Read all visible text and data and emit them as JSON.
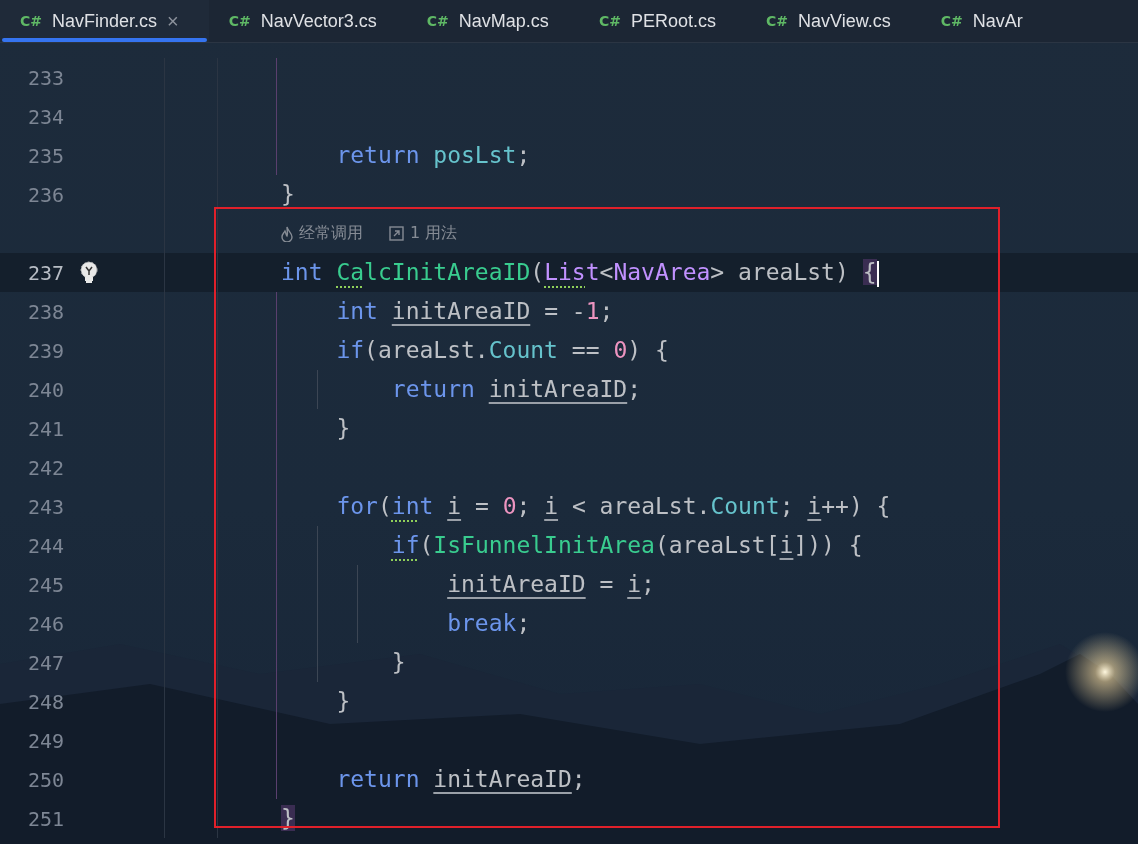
{
  "tabs": [
    {
      "icon": "C#",
      "label": "NavFinder.cs",
      "selected": true,
      "close": "×"
    },
    {
      "icon": "C#",
      "label": "NavVector3.cs",
      "selected": false
    },
    {
      "icon": "C#",
      "label": "NavMap.cs",
      "selected": false
    },
    {
      "icon": "C#",
      "label": "PERoot.cs",
      "selected": false
    },
    {
      "icon": "C#",
      "label": "NavView.cs",
      "selected": false
    },
    {
      "icon": "C#",
      "label": "NavAr",
      "selected": false
    }
  ],
  "editor": {
    "highlight_box": true,
    "lines": [
      {
        "kind": "code",
        "number": "233",
        "current": false
      },
      {
        "kind": "code",
        "number": "234",
        "current": false
      },
      {
        "kind": "code",
        "number": "235",
        "current": false,
        "tokens": [
          {
            "t": "    return ",
            "kind": "keyword"
          },
          {
            "t": "posLst",
            "kind": "field"
          },
          {
            "t": ";"
          }
        ]
      },
      {
        "kind": "code",
        "number": "236",
        "current": false,
        "tokens": [
          {
            "t": "}"
          }
        ]
      },
      {
        "kind": "hint",
        "usage_hint": "经常调用",
        "usages": "1 用法"
      },
      {
        "kind": "code",
        "number": "237",
        "current": true,
        "bulb": true,
        "caret": true,
        "tokens": [
          {
            "t": "int ",
            "kind": "keyword"
          },
          {
            "t": "Ca",
            "kind": "function",
            "hint_underline": true
          },
          {
            "t": "lcInitAreaID",
            "kind": "function"
          },
          {
            "t": "("
          },
          {
            "t": "Lis",
            "kind": "type",
            "hint_underline": true
          },
          {
            "t": "t",
            "kind": "type"
          },
          {
            "t": "<"
          },
          {
            "t": "NavArea",
            "kind": "type"
          },
          {
            "t": "> areaLst) "
          },
          {
            "t": "{",
            "brace_highlight": true
          }
        ]
      },
      {
        "kind": "code",
        "number": "238",
        "current": false,
        "tokens": [
          {
            "t": "    int ",
            "kind": "keyword"
          },
          {
            "t": "initAreaID",
            "underlined": true
          },
          {
            "t": " = -"
          },
          {
            "t": "1",
            "kind": "number"
          },
          {
            "t": ";"
          }
        ]
      },
      {
        "kind": "code",
        "number": "239",
        "current": false,
        "tokens": [
          {
            "t": "    if",
            "kind": "keyword"
          },
          {
            "t": "(areaLst."
          },
          {
            "t": "Count",
            "kind": "field"
          },
          {
            "t": " == "
          },
          {
            "t": "0",
            "kind": "number"
          },
          {
            "t": ") {"
          }
        ]
      },
      {
        "kind": "code",
        "number": "240",
        "current": false,
        "tokens": [
          {
            "t": "        return ",
            "kind": "keyword"
          },
          {
            "t": "initAreaID",
            "underlined": true
          },
          {
            "t": ";"
          }
        ]
      },
      {
        "kind": "code",
        "number": "241",
        "current": false,
        "tokens": [
          {
            "t": "    }"
          }
        ]
      },
      {
        "kind": "code",
        "number": "242",
        "current": false
      },
      {
        "kind": "code",
        "number": "243",
        "current": false,
        "tokens": [
          {
            "t": "    for",
            "kind": "keyword"
          },
          {
            "t": "("
          },
          {
            "t": "in",
            "kind": "keyword",
            "hint_underline": true
          },
          {
            "t": "t ",
            "kind": "keyword"
          },
          {
            "t": "i",
            "underlined": true
          },
          {
            "t": " = "
          },
          {
            "t": "0",
            "kind": "number"
          },
          {
            "t": "; "
          },
          {
            "t": "i",
            "underlined": true
          },
          {
            "t": " < areaLst."
          },
          {
            "t": "Count",
            "kind": "field"
          },
          {
            "t": "; "
          },
          {
            "t": "i",
            "underlined": true
          },
          {
            "t": "++) {"
          }
        ]
      },
      {
        "kind": "code",
        "number": "244",
        "current": false,
        "tokens": [
          {
            "t": "        if",
            "kind": "keyword",
            "hint_underline": true
          },
          {
            "t": "("
          },
          {
            "t": "IsFunnelInitArea",
            "kind": "function"
          },
          {
            "t": "(areaLst["
          },
          {
            "t": "i",
            "underlined": true
          },
          {
            "t": "])) {"
          }
        ]
      },
      {
        "kind": "code",
        "number": "245",
        "current": false,
        "tokens": [
          {
            "t": "            initAreaID",
            "underlined": true
          },
          {
            "t": " = "
          },
          {
            "t": "i",
            "underlined": true
          },
          {
            "t": ";"
          }
        ]
      },
      {
        "kind": "code",
        "number": "246",
        "current": false,
        "tokens": [
          {
            "t": "            break",
            "kind": "keyword"
          },
          {
            "t": ";"
          }
        ]
      },
      {
        "kind": "code",
        "number": "247",
        "current": false,
        "tokens": [
          {
            "t": "        }"
          }
        ]
      },
      {
        "kind": "code",
        "number": "248",
        "current": false,
        "tokens": [
          {
            "t": "    }"
          }
        ]
      },
      {
        "kind": "code",
        "number": "249",
        "current": false
      },
      {
        "kind": "code",
        "number": "250",
        "current": false,
        "tokens": [
          {
            "t": "    return ",
            "kind": "keyword"
          },
          {
            "t": "initAreaID",
            "underlined": true
          },
          {
            "t": ";"
          }
        ]
      },
      {
        "kind": "code",
        "number": "251",
        "current": false,
        "tokens": [
          {
            "t": "}",
            "brace_highlight": true
          }
        ]
      }
    ]
  }
}
